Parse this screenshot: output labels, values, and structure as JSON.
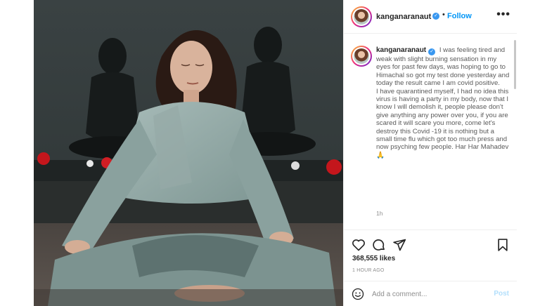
{
  "post": {
    "username": "kanganaranaut",
    "verified_icon": "verified-badge-icon",
    "follow_label": "Follow",
    "more_label": "•••",
    "header_separator": "•",
    "caption_paragraphs": [
      "I was feeling tired and weak with slight burning sensation in my eyes for past few days, was hoping to go to Himachal so got my test done yesterday and today the result came I am covid positive.",
      "I have quarantined myself, I had no idea this virus is having a party in my body, now that I know I will demolish it, people please don't give anything any power over you, if you are scared it will scare you more, come let's destroy this Covid -19 it is nothing but a small time flu which got too much press and now psyching few people. Har Har Mahadev 🙏"
    ],
    "caption_time": "1h",
    "likes": "368,555 likes",
    "time_ago": "1 HOUR AGO",
    "comment_placeholder": "Add a comment...",
    "post_button": "Post"
  },
  "icons": {
    "like": "heart-icon",
    "comment": "comment-icon",
    "share": "paper-plane-icon",
    "save": "bookmark-icon",
    "emoji": "smiley-icon"
  },
  "colors": {
    "follow_blue": "#0095f6",
    "verified_blue": "#3897f0",
    "post_disabled": "#b2dffc",
    "muted_text": "#8e8e8e"
  }
}
